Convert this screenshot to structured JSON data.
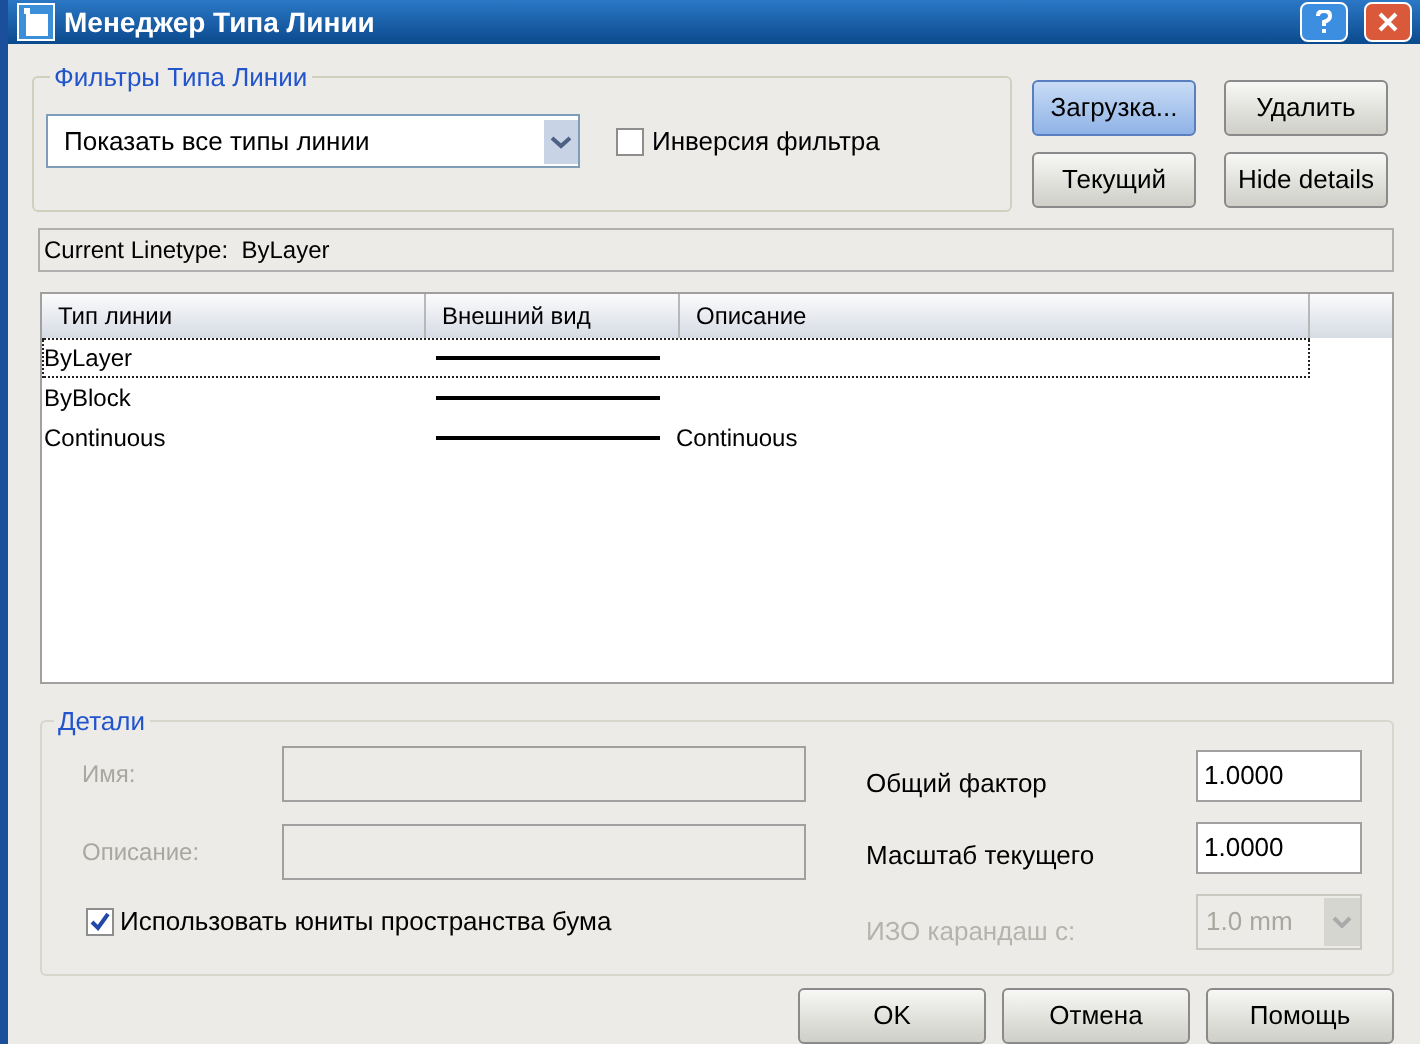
{
  "window": {
    "title": "Менеджер Типа Линии"
  },
  "filters": {
    "title": "Фильтры Типа Линии",
    "dropdown_value": "Показать все типы линии",
    "invert": {
      "label": "Инверсия фильтра",
      "checked": false
    }
  },
  "top_buttons": [
    {
      "label": "Загрузка...",
      "focused": true
    },
    {
      "label": "Удалить",
      "focused": false
    },
    {
      "label": "Текущий",
      "focused": false
    },
    {
      "label": "Hide details",
      "focused": false
    }
  ],
  "current_linetype": "Current Linetype:  ByLayer",
  "table": {
    "columns": [
      "Тип линии",
      "Внешний вид",
      "Описание"
    ],
    "rows": [
      {
        "name": "ByLayer",
        "description": "",
        "focused": true
      },
      {
        "name": "ByBlock",
        "description": "",
        "focused": false
      },
      {
        "name": "Continuous",
        "description": "Continuous",
        "focused": false
      }
    ]
  },
  "details": {
    "title": "Детали",
    "fields": [
      {
        "label": "Имя:",
        "disabled": true
      },
      {
        "label": "Описание:",
        "disabled": true
      }
    ],
    "paper_units": {
      "label": "Использовать юниты пространства бума",
      "checked": true
    },
    "global_factor": {
      "label": "Общий фактор",
      "value": "1.0000"
    },
    "current_scale": {
      "label": "Масштаб текущего",
      "value": "1.0000"
    },
    "iso_pen": {
      "label": "ИЗО карандаш с:",
      "value": "1.0 mm",
      "disabled": true
    }
  },
  "footer_buttons": [
    "OK",
    "Отмена",
    "Помощь"
  ]
}
